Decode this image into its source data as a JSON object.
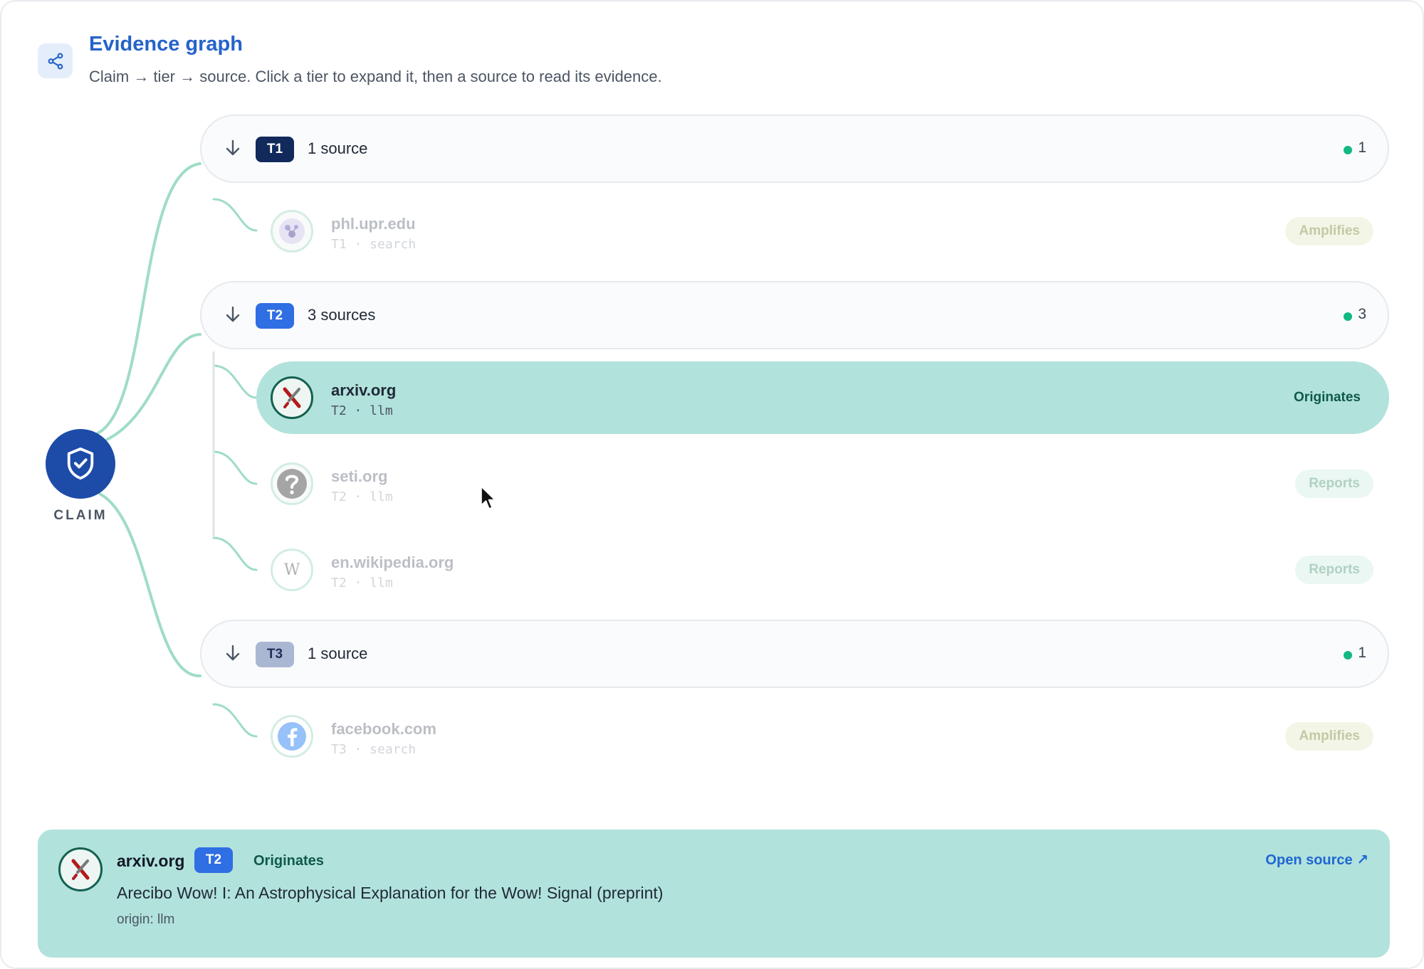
{
  "header": {
    "icon": "share-icon",
    "title": "Evidence graph",
    "subtitle": "Claim → tier → source. Click a tier to expand it, then a source to read its evidence."
  },
  "claim": {
    "icon": "shield-check-icon",
    "label": "CLAIM"
  },
  "tiers": [
    {
      "badge": "T1",
      "badge_color": "#12295c",
      "count_label": "1 source",
      "count": "1",
      "sources": [
        {
          "domain": "phl.upr.edu",
          "meta": "T1 · search",
          "role": "Amplifies",
          "icon": "phl-logo-icon"
        }
      ]
    },
    {
      "badge": "T2",
      "badge_color": "#2f6ee3",
      "count_label": "3 sources",
      "count": "3",
      "sources": [
        {
          "domain": "arxiv.org",
          "meta": "T2 · llm",
          "role": "Originates",
          "icon": "arxiv-icon"
        },
        {
          "domain": "seti.org",
          "meta": "T2 · llm",
          "role": "Reports",
          "icon": "question-icon"
        },
        {
          "domain": "en.wikipedia.org",
          "meta": "T2 · llm",
          "role": "Reports",
          "icon": "wikipedia-icon"
        }
      ]
    },
    {
      "badge": "T3",
      "badge_color": "#aab7d3",
      "count_label": "1 source",
      "count": "1",
      "sources": [
        {
          "domain": "facebook.com",
          "meta": "T3 · search",
          "role": "Amplifies",
          "icon": "facebook-icon"
        }
      ]
    }
  ],
  "detail": {
    "domain": "arxiv.org",
    "tier": "T2",
    "role": "Originates",
    "title": "Arecibo Wow! I: An Astrophysical Explanation for the Wow! Signal (preprint)",
    "origin": "origin: llm",
    "open_label": "Open source ↗"
  },
  "colors": {
    "accent": "#2563c9",
    "claim": "#1d4ba8",
    "active_row": "#b2e2dc",
    "link": "#9fdcc6",
    "status_dot": "#10b981"
  }
}
